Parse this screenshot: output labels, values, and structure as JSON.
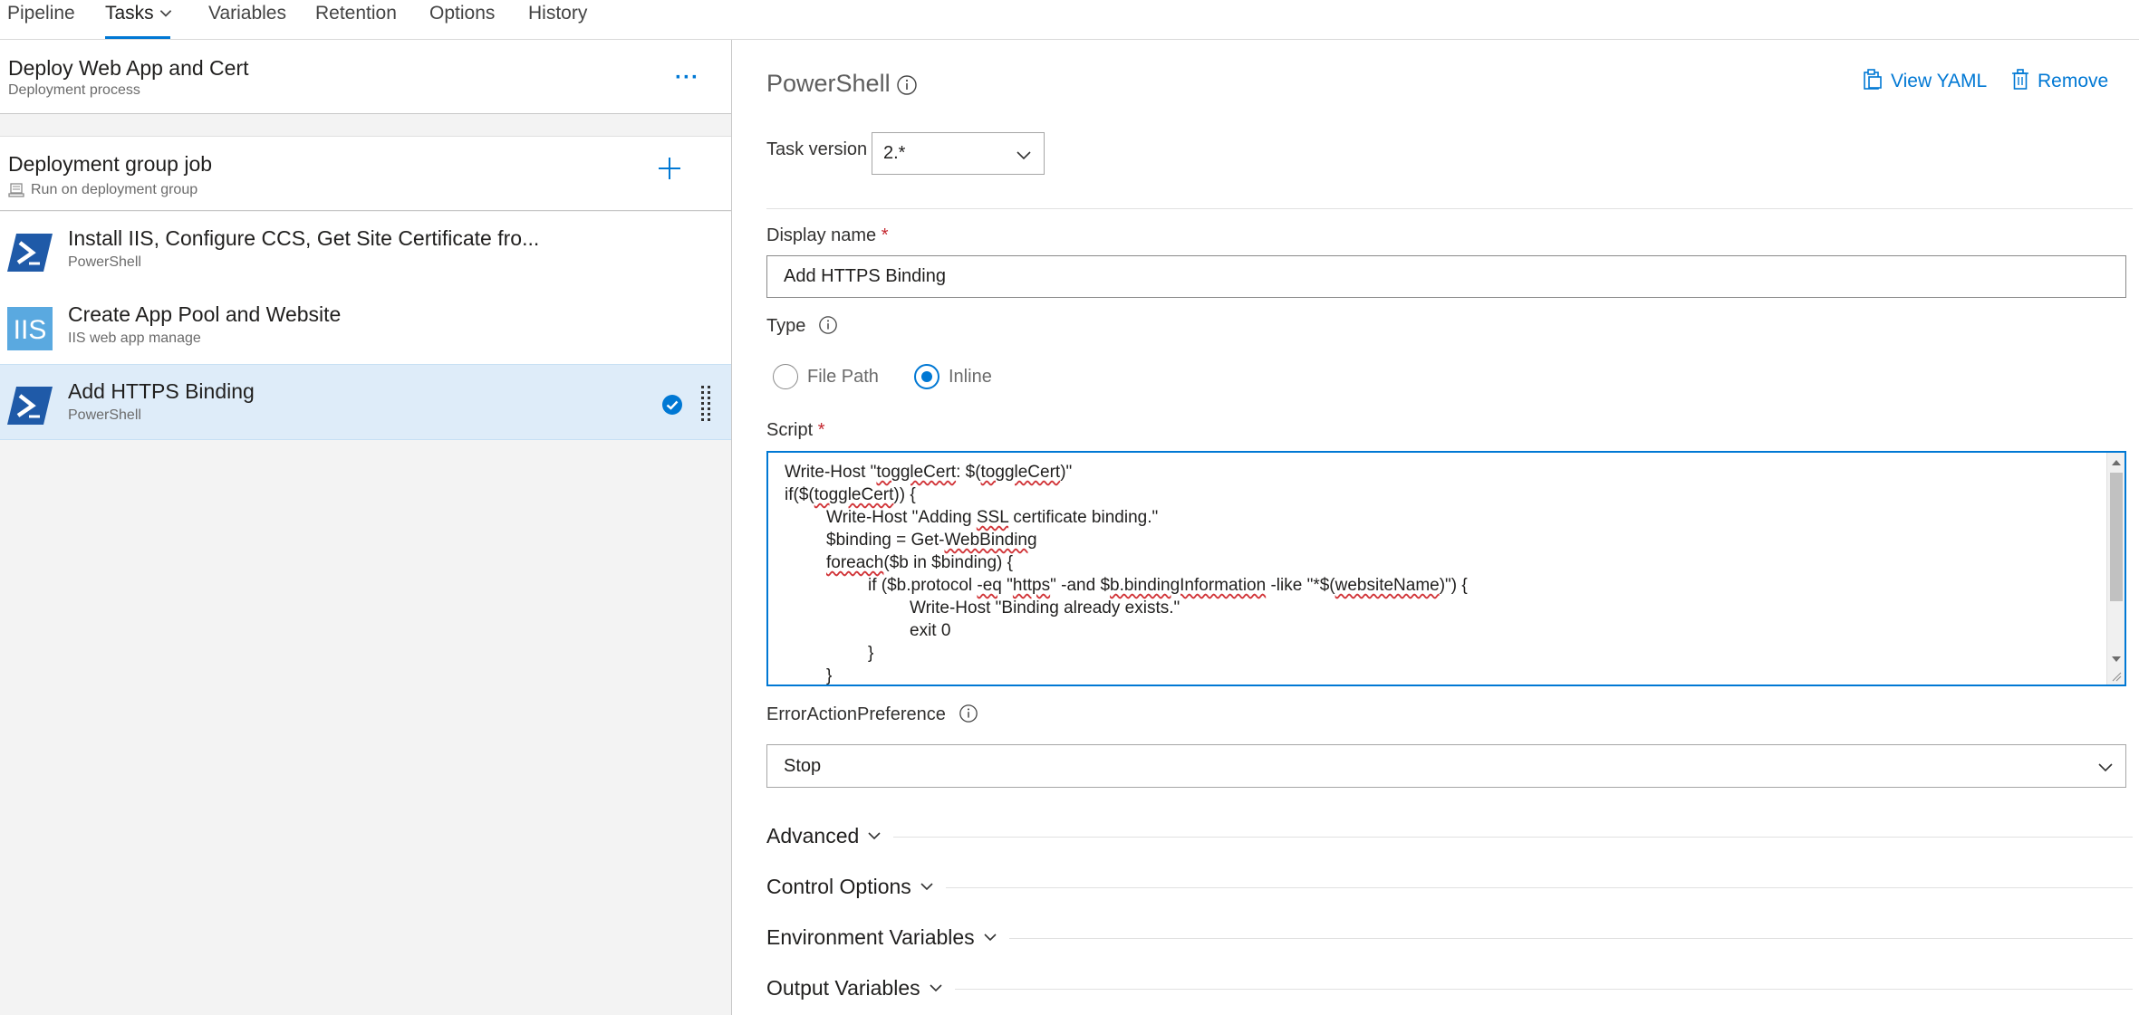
{
  "nav": {
    "tabs": [
      {
        "label": "Pipeline"
      },
      {
        "label": "Tasks"
      },
      {
        "label": "Variables"
      },
      {
        "label": "Retention"
      },
      {
        "label": "Options"
      },
      {
        "label": "History"
      }
    ],
    "active_tab": "Tasks"
  },
  "process": {
    "title": "Deploy Web App and Cert",
    "subtitle": "Deployment process",
    "more_icon": "ellipsis-icon"
  },
  "job": {
    "title": "Deployment group job",
    "subtitle": "Run on deployment group"
  },
  "tasks": [
    {
      "name": "Install IIS, Configure CCS, Get Site Certificate fro...",
      "type": "PowerShell",
      "icon": "powershell-icon"
    },
    {
      "name": "Create App Pool and Website",
      "type": "IIS web app manage",
      "icon": "iis-icon"
    },
    {
      "name": "Add HTTPS Binding",
      "type": "PowerShell",
      "icon": "powershell-icon",
      "selected": true
    }
  ],
  "detail": {
    "title": "PowerShell",
    "view_yaml": "View YAML",
    "remove": "Remove",
    "task_version_label": "Task version",
    "task_version_value": "2.*",
    "display_name_label": "Display name",
    "required_mark": "*",
    "display_name_value": "Add HTTPS Binding",
    "type_label": "Type",
    "type_options": [
      "File Path",
      "Inline"
    ],
    "type_selected": "Inline",
    "script_label": "Script",
    "script_lines": [
      "Write-Host \"toggleCert: $(toggleCert)\"",
      "if($(toggleCert)) {",
      "\tWrite-Host \"Adding SSL certificate binding.\"",
      "\t$binding = Get-WebBinding",
      "\tforeach($b in $binding) {",
      "\t\tif ($b.protocol -eq \"https\" -and $b.bindingInformation -like \"*$(websiteName)\") {",
      "\t\t\tWrite-Host \"Binding already exists.\"",
      "\t\t\texit 0",
      "\t\t}",
      "\t}"
    ],
    "error_pref_label": "ErrorActionPreference",
    "error_pref_value": "Stop",
    "sections": [
      "Advanced",
      "Control Options",
      "Environment Variables",
      "Output Variables"
    ]
  },
  "colors": {
    "accent": "#0078d4",
    "selected_row": "#deecf9",
    "required": "#c4262e",
    "powershell": "#1f5aa8",
    "iis": "#5aa9e0"
  }
}
